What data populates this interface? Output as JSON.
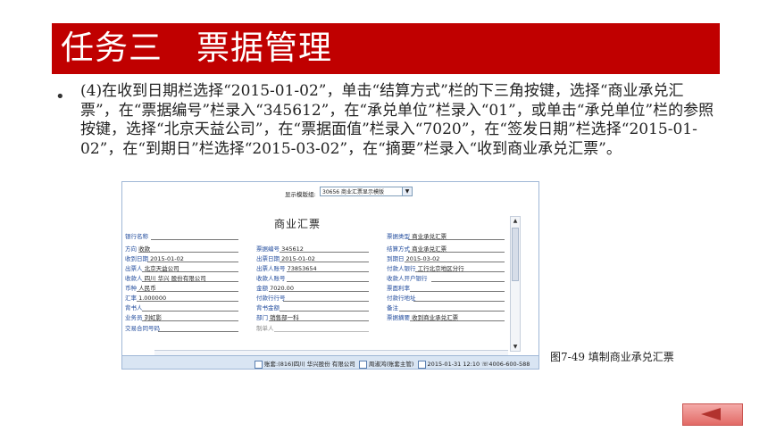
{
  "slide": {
    "title": "任务三　票据管理",
    "bullet": "•",
    "instruction": "(4)在收到日期栏选择“2015-01-02”，单击“结算方式”栏的下三角按键，选择“商业承兑汇票”，在“票据编号”栏录入“345612”，在“承兑单位”栏录入“01”，或单击“承兑单位”栏的参照按键，选择“北京天益公司”，在“票据面值”栏录入“7020”，在“签发日期”栏选择“2015-01-02”，在“到期日”栏选择“2015-03-02”，在“摘要”栏录入“收到商业承兑汇票”。",
    "caption": "图7-49  填制商业承兑汇票"
  },
  "screenshot": {
    "template_label": "显示模版组:",
    "template_value": "30656 商业汇票显示模版",
    "form_title": "商业汇票",
    "fields": {
      "bank_name": {
        "label": "银行名称",
        "value": ""
      },
      "bill_type": {
        "label": "票据类型",
        "value": "商业承兑汇票"
      },
      "direction": {
        "label": "方向",
        "value": "收款"
      },
      "bill_no": {
        "label": "票据编号",
        "value": "345612"
      },
      "settlement": {
        "label": "结算方式",
        "value": "商业承兑汇票"
      },
      "receive_date": {
        "label": "收到日期",
        "value": "2015-01-02"
      },
      "issue_date": {
        "label": "出票日期",
        "value": "2015-01-02"
      },
      "due_date": {
        "label": "到期日",
        "value": "2015-03-02"
      },
      "drawer": {
        "label": "出票人",
        "value": "北京天益公司"
      },
      "drawer_account": {
        "label": "出票人账号",
        "value": "73853654"
      },
      "payer_bank": {
        "label": "付款人银行",
        "value": "工行北京地区分行"
      },
      "payee": {
        "label": "收款人",
        "value": "四川 华兴 股份有限公司"
      },
      "payee_account": {
        "label": "收款人账号",
        "value": ""
      },
      "payee_bank": {
        "label": "收款人开户银行",
        "value": ""
      },
      "currency": {
        "label": "币种",
        "value": "人民币"
      },
      "amount": {
        "label": "金额",
        "value": "7020.00"
      },
      "face_rate": {
        "label": "票面利率",
        "value": ""
      },
      "exchange_rate": {
        "label": "汇率",
        "value": "1.000000"
      },
      "payer_bank_code": {
        "label": "付款行行号",
        "value": ""
      },
      "payer_bank_addr": {
        "label": "付款行地址",
        "value": ""
      },
      "endorser": {
        "label": "背书人",
        "value": ""
      },
      "endorse_amount": {
        "label": "背书金额",
        "value": ""
      },
      "note": {
        "label": "备注",
        "value": ""
      },
      "salesperson": {
        "label": "业务员",
        "value": "刘虹影"
      },
      "department": {
        "label": "部门",
        "value": "销售部一科"
      },
      "summary": {
        "label": "票据摘要",
        "value": "收到商业承兑汇票"
      },
      "contract_no": {
        "label": "交易合同号码",
        "value": ""
      },
      "maker": {
        "label": "制单人",
        "value": ""
      }
    },
    "status_bar": {
      "account": "账套:(816)四川 华兴股份 有限公司",
      "user": "周淑鸿(账套主管)",
      "datetime": "2015-01-31 12:10",
      "phone": "4006-600-588"
    }
  },
  "colors": {
    "title_bar": "#c00000",
    "field_label": "#1f4a9c",
    "back_button": "#e26a66"
  },
  "icons": {
    "back": "left-arrow-icon"
  }
}
